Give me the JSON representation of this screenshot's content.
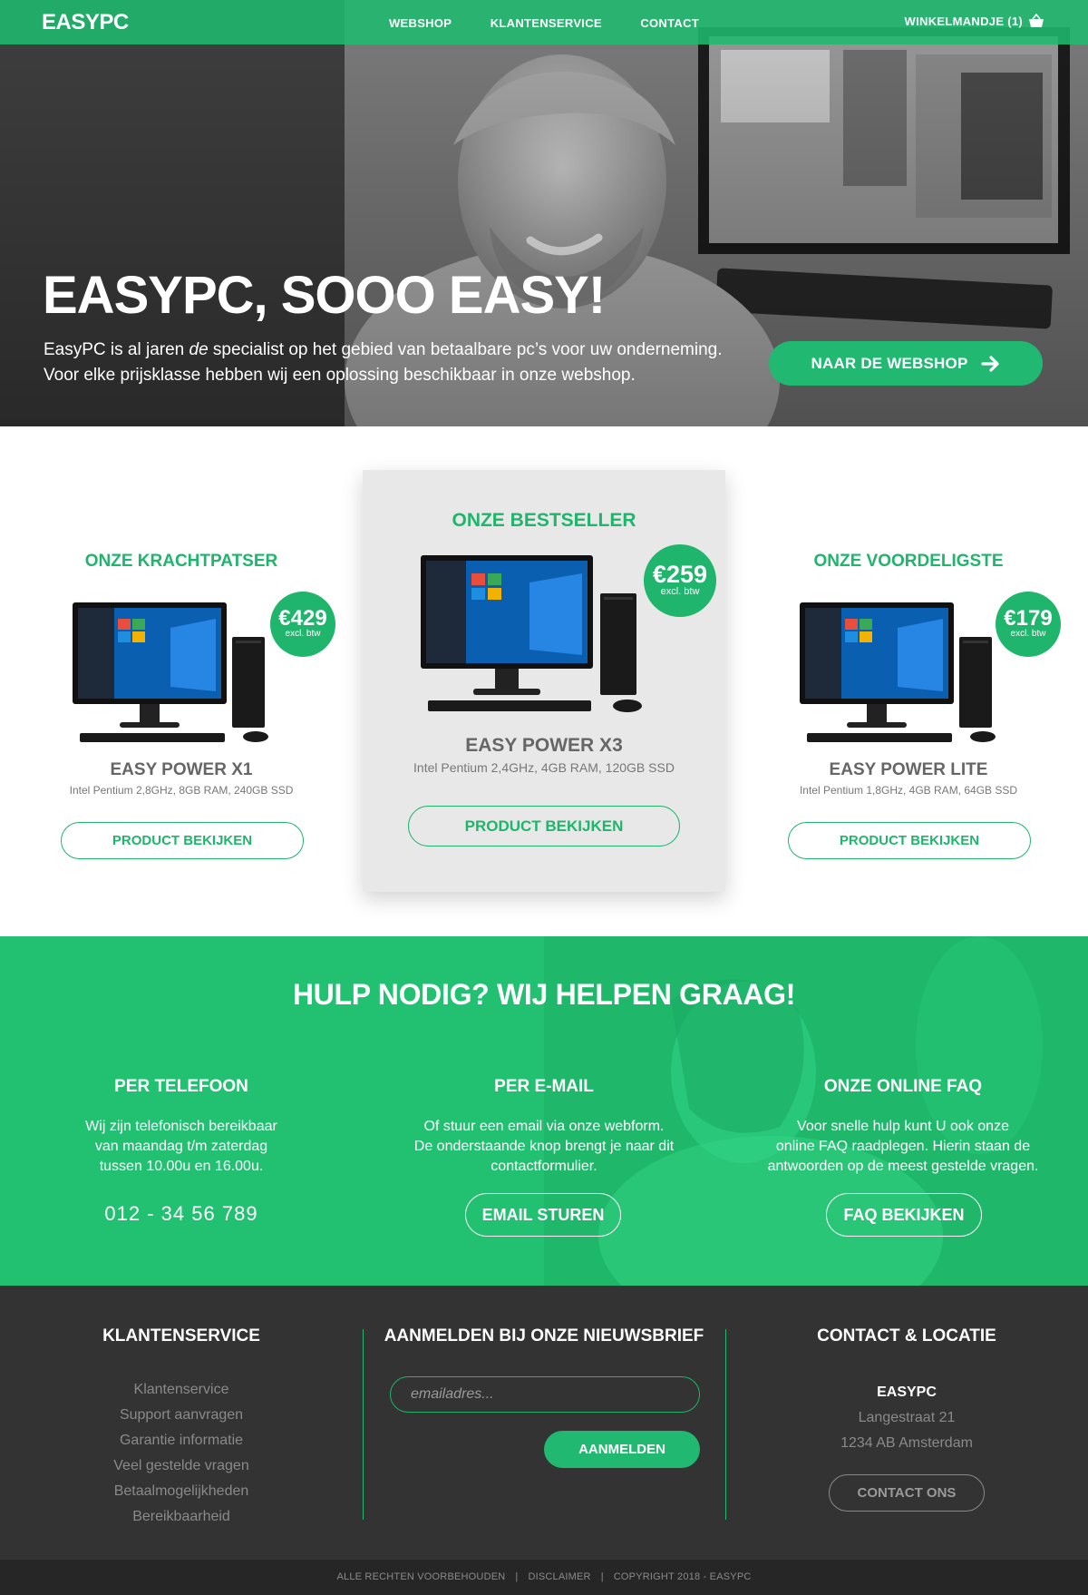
{
  "brand": {
    "logo": "EASYPC",
    "accent": "#21b971",
    "dark": "#333333"
  },
  "nav": {
    "items": [
      {
        "label": "WEBSHOP"
      },
      {
        "label": "KLANTENSERVICE"
      },
      {
        "label": "CONTACT"
      }
    ],
    "cart_label": "WINKELMANDJE (1)",
    "cart_icon": "basket-icon"
  },
  "hero": {
    "title": "EASYPC, SOOO EASY!",
    "text_line1_pre": "EasyPC is al jaren ",
    "text_line1_em": "de",
    "text_line1_post": " specialist op het gebied van betaalbare pc’s voor uw onderneming.",
    "text_line2": "Voor elke prijsklasse hebben wij een oplossing beschikbaar in onze webshop.",
    "cta_label": "NAAR DE WEBSHOP",
    "cta_icon": "arrow-right-icon"
  },
  "products": [
    {
      "tag": "ONZE KRACHTPATSER",
      "price": "€429",
      "price_note": "excl. btw",
      "name": "EASY POWER X1",
      "spec": "Intel Pentium 2,8GHz, 8GB RAM, 240GB SSD",
      "button": "PRODUCT BEKIJKEN"
    },
    {
      "tag": "ONZE BESTSELLER",
      "price": "€259",
      "price_note": "excl. btw",
      "name": "EASY POWER X3",
      "spec": "Intel Pentium 2,4GHz, 4GB RAM, 120GB SSD",
      "button": "PRODUCT BEKIJKEN"
    },
    {
      "tag": "ONZE VOORDELIGSTE",
      "price": "€179",
      "price_note": "excl. btw",
      "name": "EASY POWER LITE",
      "spec": "Intel Pentium 1,8GHz, 4GB RAM, 64GB SSD",
      "button": "PRODUCT BEKIJKEN"
    }
  ],
  "help": {
    "title": "HULP NODIG? WIJ HELPEN GRAAG!",
    "phone": {
      "heading": "PER TELEFOON",
      "lines": [
        "Wij zijn telefonisch bereikbaar",
        "van maandag t/m zaterdag",
        "tussen 10.00u en 16.00u."
      ],
      "number": "012 - 34 56 789"
    },
    "email": {
      "heading": "PER E-MAIL",
      "lines": [
        "Of stuur een email via onze webform.",
        "De onderstaande knop brengt je naar dit",
        "contactformulier."
      ],
      "button": "EMAIL STUREN"
    },
    "faq": {
      "heading": "ONZE ONLINE FAQ",
      "lines": [
        "Voor snelle hulp kunt U ook onze",
        "online FAQ raadplegen. Hierin staan de",
        "antwoorden op de meest gestelde vragen."
      ],
      "button": "FAQ BEKIJKEN"
    }
  },
  "footer": {
    "service": {
      "heading": "KLANTENSERVICE",
      "links": [
        "Klantenservice",
        "Support aanvragen",
        "Garantie informatie",
        "Veel gestelde vragen",
        "Betaalmogelijkheden",
        "Bereikbaarheid"
      ]
    },
    "newsletter": {
      "heading": "AANMELDEN BIJ ONZE NIEUWSBRIEF",
      "placeholder": "emailadres...",
      "button": "AANMELDEN"
    },
    "contact": {
      "heading": "CONTACT & LOCATIE",
      "company": "EASYPC",
      "street": "Langestraat 21",
      "city": "1234 AB Amsterdam",
      "button": "CONTACT ONS"
    }
  },
  "bottom_bar": {
    "rights": "ALLE RECHTEN VOORBEHOUDEN",
    "disclaimer": "DISCLAIMER",
    "copyright": "COPYRIGHT 2018 - EASYPC"
  }
}
